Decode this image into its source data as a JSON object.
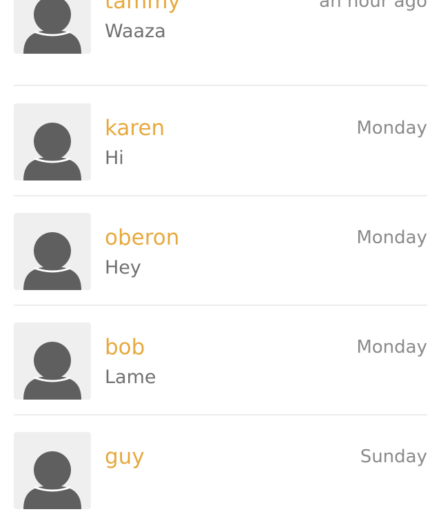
{
  "colors": {
    "name": "#e6a93e",
    "message": "#707070",
    "time": "#8a8a8a",
    "avatar_bg": "#efefef",
    "avatar_fg": "#5f5f5f",
    "divider": "#ececec"
  },
  "conversations": [
    {
      "name": "tammy",
      "message": "Waaza",
      "time": "an hour ago",
      "avatar_icon": "user-silhouette-icon"
    },
    {
      "name": "karen",
      "message": "Hi",
      "time": "Monday",
      "avatar_icon": "user-silhouette-icon"
    },
    {
      "name": "oberon",
      "message": "Hey",
      "time": "Monday",
      "avatar_icon": "user-silhouette-icon"
    },
    {
      "name": "bob",
      "message": "Lame",
      "time": "Monday",
      "avatar_icon": "user-silhouette-icon"
    },
    {
      "name": "guy",
      "message": "",
      "time": "Sunday",
      "avatar_icon": "user-silhouette-icon"
    }
  ]
}
